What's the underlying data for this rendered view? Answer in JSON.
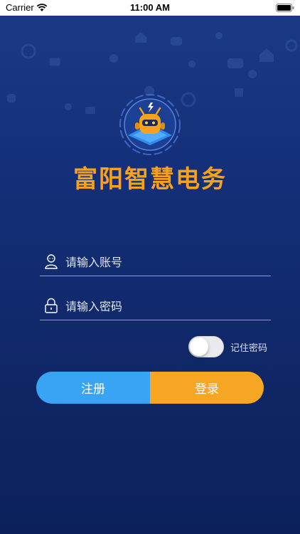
{
  "status_bar": {
    "carrier": "Carrier",
    "time": "11:00 AM"
  },
  "app": {
    "title": "富阳智慧电务",
    "logo_icon": "robot-chip-icon"
  },
  "login": {
    "account_placeholder": "请输入账号",
    "password_placeholder": "请输入密码",
    "remember_label": "记住密码",
    "remember_on": false,
    "register_label": "注册",
    "login_label": "登录"
  },
  "colors": {
    "brand": "#f6a21c",
    "register": "#3aa4f4",
    "login": "#f6a622",
    "background": "#15307a"
  }
}
